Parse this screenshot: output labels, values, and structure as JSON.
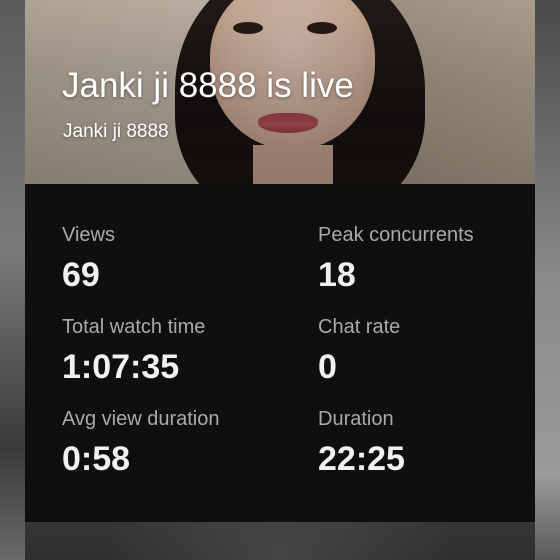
{
  "stream": {
    "title": "Janki ji 8888 is live",
    "channel_name": "Janki ji 8888"
  },
  "stats": [
    {
      "label": "Views",
      "value": "69"
    },
    {
      "label": "Peak concurrents",
      "value": "18"
    },
    {
      "label": "Total watch time",
      "value": "1:07:35"
    },
    {
      "label": "Chat rate",
      "value": "0"
    },
    {
      "label": "Avg view duration",
      "value": "0:58"
    },
    {
      "label": "Duration",
      "value": "22:25"
    }
  ],
  "colors": {
    "panel_background": "#0f0f0f",
    "label_text": "#aaaaaa",
    "value_text": "#f1f1f1",
    "title_text": "#ffffff"
  }
}
